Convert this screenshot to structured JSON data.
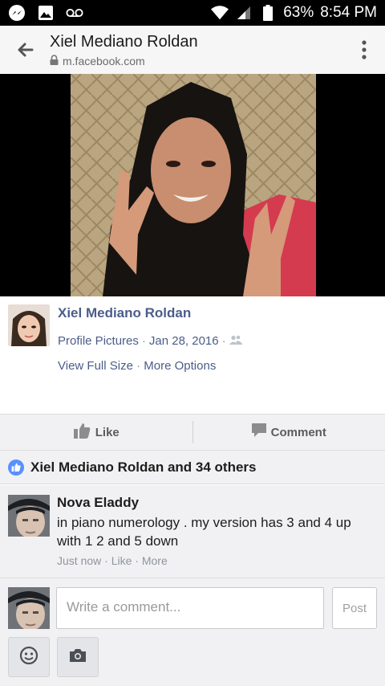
{
  "status_bar": {
    "battery": "63%",
    "time": "8:54 PM",
    "icons": [
      "messenger-icon",
      "image-icon",
      "voicemail-icon",
      "wifi-icon",
      "signal-icon",
      "battery-icon"
    ]
  },
  "browser": {
    "title": "Xiel Mediano Roldan",
    "url": "m.facebook.com"
  },
  "post": {
    "author": "Xiel Mediano Roldan",
    "album": "Profile Pictures",
    "separator": " · ",
    "date": "Jan 28, 2016",
    "view_full_size": "View Full Size",
    "more_options": "More Options"
  },
  "actions": {
    "like": "Like",
    "comment": "Comment"
  },
  "likes_summary": "Xiel Mediano Roldan and 34 others",
  "comment": {
    "author": "Nova Eladdy",
    "text": "in piano numerology . my version has 3 and 4 up with 1 2 and 5 down",
    "time": "Just now",
    "like": "Like",
    "more": "More"
  },
  "composer": {
    "placeholder": "Write a comment...",
    "post_label": "Post"
  },
  "colors": {
    "link": "#4b5d8a",
    "like_blue": "#5890ff",
    "background": "#f1f1f3"
  }
}
